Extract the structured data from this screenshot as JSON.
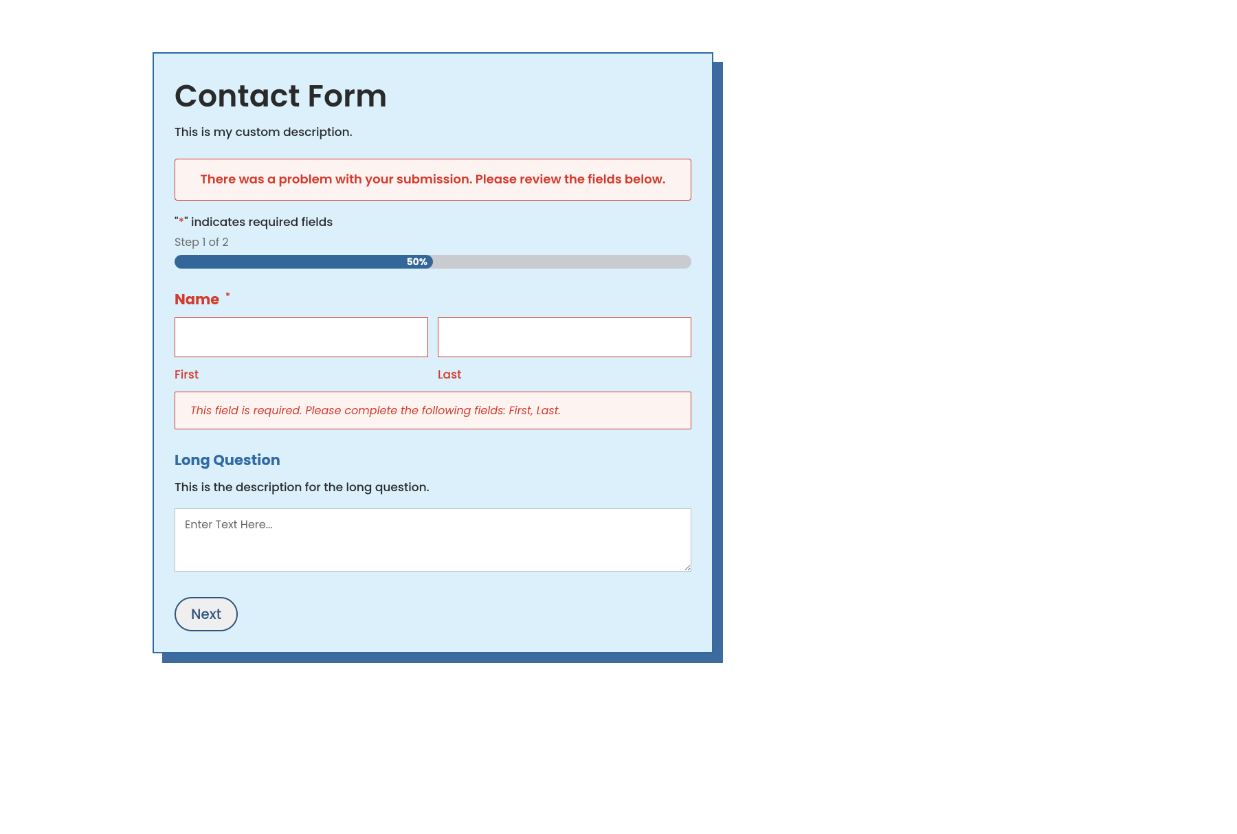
{
  "form": {
    "title": "Contact Form",
    "description": "This is my custom description.",
    "error_banner": "There was a problem with your submission. Please review the fields below.",
    "required_note_prefix": "\"",
    "required_note_asterisk": "*",
    "required_note_suffix": "\" indicates required fields",
    "step_label": "Step 1 of 2",
    "progress_percent_label": "50%",
    "progress_percent_value": 50,
    "name_field": {
      "label": "Name",
      "required_mark": "*",
      "first_sublabel": "First",
      "last_sublabel": "Last",
      "first_value": "",
      "last_value": "",
      "error_message": "This field is required. Please complete the following fields: First, Last."
    },
    "long_question": {
      "label": "Long Question",
      "description": "This is the description for the long question.",
      "placeholder": "Enter Text Here...",
      "value": ""
    },
    "next_button_label": "Next"
  }
}
